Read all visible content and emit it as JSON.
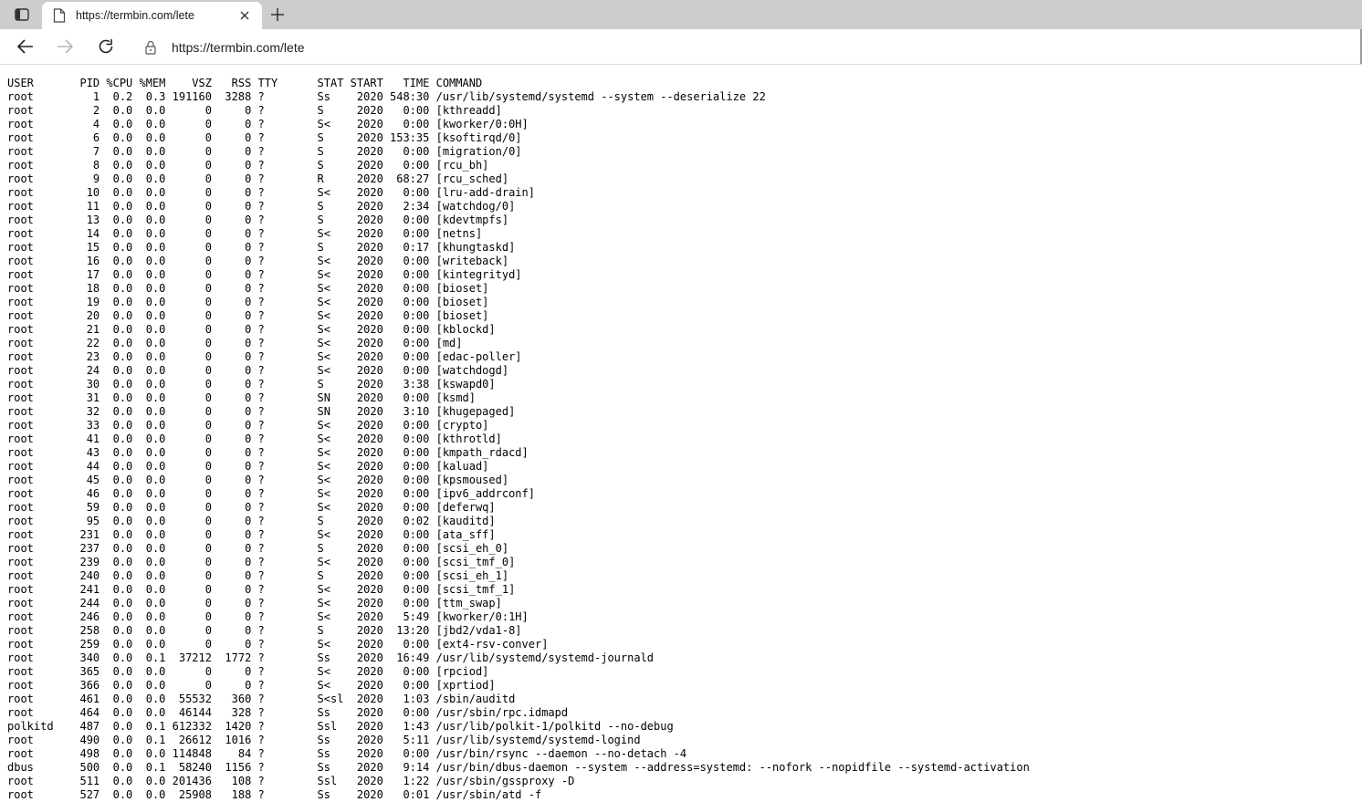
{
  "browser": {
    "tab_title": "https://termbin.com/lete",
    "url": "https://termbin.com/lete",
    "icons": {
      "sidebar": "sidebar-toggle-icon",
      "favicon": "page-icon",
      "close": "close-icon",
      "new_tab": "plus-icon",
      "back": "back-arrow-icon",
      "forward": "forward-arrow-icon",
      "reload": "reload-icon",
      "lock": "lock-icon"
    },
    "colors": {
      "tabstrip": "#cdcdcd",
      "toolbar": "#ffffff"
    }
  },
  "ps": {
    "header": "USER       PID %CPU %MEM    VSZ   RSS TTY      STAT START   TIME COMMAND",
    "rows": [
      "root         1  0.2  0.3 191160  3288 ?        Ss    2020 548:30 /usr/lib/systemd/systemd --system --deserialize 22",
      "root         2  0.0  0.0      0     0 ?        S     2020   0:00 [kthreadd]",
      "root         4  0.0  0.0      0     0 ?        S<    2020   0:00 [kworker/0:0H]",
      "root         6  0.0  0.0      0     0 ?        S     2020 153:35 [ksoftirqd/0]",
      "root         7  0.0  0.0      0     0 ?        S     2020   0:00 [migration/0]",
      "root         8  0.0  0.0      0     0 ?        S     2020   0:00 [rcu_bh]",
      "root         9  0.0  0.0      0     0 ?        R     2020  68:27 [rcu_sched]",
      "root        10  0.0  0.0      0     0 ?        S<    2020   0:00 [lru-add-drain]",
      "root        11  0.0  0.0      0     0 ?        S     2020   2:34 [watchdog/0]",
      "root        13  0.0  0.0      0     0 ?        S     2020   0:00 [kdevtmpfs]",
      "root        14  0.0  0.0      0     0 ?        S<    2020   0:00 [netns]",
      "root        15  0.0  0.0      0     0 ?        S     2020   0:17 [khungtaskd]",
      "root        16  0.0  0.0      0     0 ?        S<    2020   0:00 [writeback]",
      "root        17  0.0  0.0      0     0 ?        S<    2020   0:00 [kintegrityd]",
      "root        18  0.0  0.0      0     0 ?        S<    2020   0:00 [bioset]",
      "root        19  0.0  0.0      0     0 ?        S<    2020   0:00 [bioset]",
      "root        20  0.0  0.0      0     0 ?        S<    2020   0:00 [bioset]",
      "root        21  0.0  0.0      0     0 ?        S<    2020   0:00 [kblockd]",
      "root        22  0.0  0.0      0     0 ?        S<    2020   0:00 [md]",
      "root        23  0.0  0.0      0     0 ?        S<    2020   0:00 [edac-poller]",
      "root        24  0.0  0.0      0     0 ?        S<    2020   0:00 [watchdogd]",
      "root        30  0.0  0.0      0     0 ?        S     2020   3:38 [kswapd0]",
      "root        31  0.0  0.0      0     0 ?        SN    2020   0:00 [ksmd]",
      "root        32  0.0  0.0      0     0 ?        SN    2020   3:10 [khugepaged]",
      "root        33  0.0  0.0      0     0 ?        S<    2020   0:00 [crypto]",
      "root        41  0.0  0.0      0     0 ?        S<    2020   0:00 [kthrotld]",
      "root        43  0.0  0.0      0     0 ?        S<    2020   0:00 [kmpath_rdacd]",
      "root        44  0.0  0.0      0     0 ?        S<    2020   0:00 [kaluad]",
      "root        45  0.0  0.0      0     0 ?        S<    2020   0:00 [kpsmoused]",
      "root        46  0.0  0.0      0     0 ?        S<    2020   0:00 [ipv6_addrconf]",
      "root        59  0.0  0.0      0     0 ?        S<    2020   0:00 [deferwq]",
      "root        95  0.0  0.0      0     0 ?        S     2020   0:02 [kauditd]",
      "root       231  0.0  0.0      0     0 ?        S<    2020   0:00 [ata_sff]",
      "root       237  0.0  0.0      0     0 ?        S     2020   0:00 [scsi_eh_0]",
      "root       239  0.0  0.0      0     0 ?        S<    2020   0:00 [scsi_tmf_0]",
      "root       240  0.0  0.0      0     0 ?        S     2020   0:00 [scsi_eh_1]",
      "root       241  0.0  0.0      0     0 ?        S<    2020   0:00 [scsi_tmf_1]",
      "root       244  0.0  0.0      0     0 ?        S<    2020   0:00 [ttm_swap]",
      "root       246  0.0  0.0      0     0 ?        S<    2020   5:49 [kworker/0:1H]",
      "root       258  0.0  0.0      0     0 ?        S     2020  13:20 [jbd2/vda1-8]",
      "root       259  0.0  0.0      0     0 ?        S<    2020   0:00 [ext4-rsv-conver]",
      "root       340  0.0  0.1  37212  1772 ?        Ss    2020  16:49 /usr/lib/systemd/systemd-journald",
      "root       365  0.0  0.0      0     0 ?        S<    2020   0:00 [rpciod]",
      "root       366  0.0  0.0      0     0 ?        S<    2020   0:00 [xprtiod]",
      "root       461  0.0  0.0  55532   360 ?        S<sl  2020   1:03 /sbin/auditd",
      "root       464  0.0  0.0  46144   328 ?        Ss    2020   0:00 /usr/sbin/rpc.idmapd",
      "polkitd    487  0.0  0.1 612332  1420 ?        Ssl   2020   1:43 /usr/lib/polkit-1/polkitd --no-debug",
      "root       490  0.0  0.1  26612  1016 ?        Ss    2020   5:11 /usr/lib/systemd/systemd-logind",
      "root       498  0.0  0.0 114848    84 ?        Ss    2020   0:00 /usr/bin/rsync --daemon --no-detach -4",
      "dbus       500  0.0  0.1  58240  1156 ?        Ss    2020   9:14 /usr/bin/dbus-daemon --system --address=systemd: --nofork --nopidfile --systemd-activation",
      "root       511  0.0  0.0 201436   108 ?        Ssl   2020   1:22 /usr/sbin/gssproxy -D",
      "root       527  0.0  0.0  25908   188 ?        Ss    2020   0:01 /usr/sbin/atd -f"
    ]
  }
}
